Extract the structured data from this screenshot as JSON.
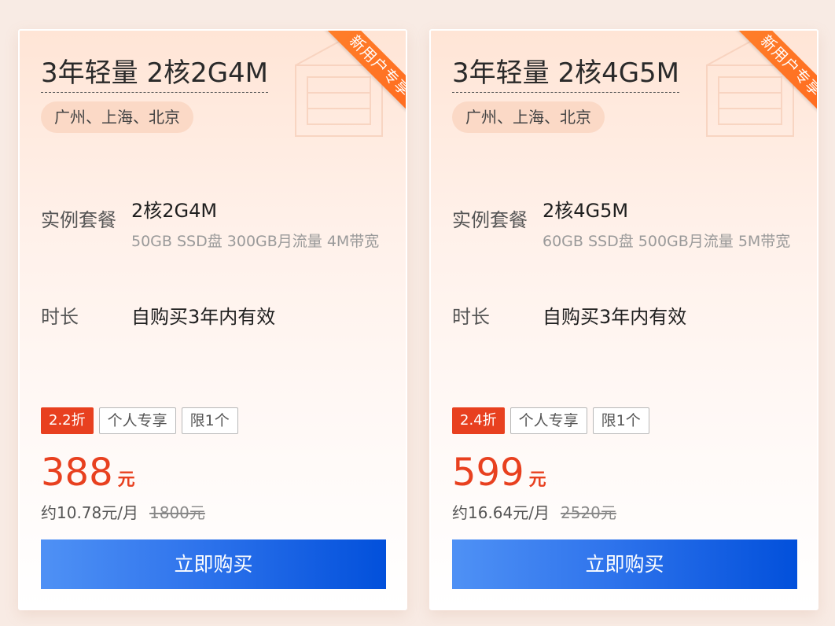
{
  "cards": [
    {
      "badge": "新用户专享",
      "title": "3年轻量 2核2G4M",
      "regions": "广州、上海、北京",
      "spec_label": "实例套餐",
      "spec_value": "2核2G4M",
      "spec_detail": "50GB SSD盘 300GB月流量 4M带宽",
      "duration_label": "时长",
      "duration_value": "自购买3年内有效",
      "tags": [
        "2.2折",
        "个人专享",
        "限1个"
      ],
      "price": "388",
      "price_unit": "元",
      "monthly": "约10.78元/月",
      "original_price": "1800元",
      "button": "立即购买"
    },
    {
      "badge": "新用户专享",
      "title": "3年轻量 2核4G5M",
      "regions": "广州、上海、北京",
      "spec_label": "实例套餐",
      "spec_value": "2核4G5M",
      "spec_detail": "60GB SSD盘 500GB月流量 5M带宽",
      "duration_label": "时长",
      "duration_value": "自购买3年内有效",
      "tags": [
        "2.4折",
        "个人专享",
        "限1个"
      ],
      "price": "599",
      "price_unit": "元",
      "monthly": "约16.64元/月",
      "original_price": "2520元",
      "button": "立即购买"
    }
  ],
  "colors": {
    "accent_red": "#e8401f",
    "ribbon_orange": "#ff7f2a",
    "button_blue": "#0250db"
  }
}
